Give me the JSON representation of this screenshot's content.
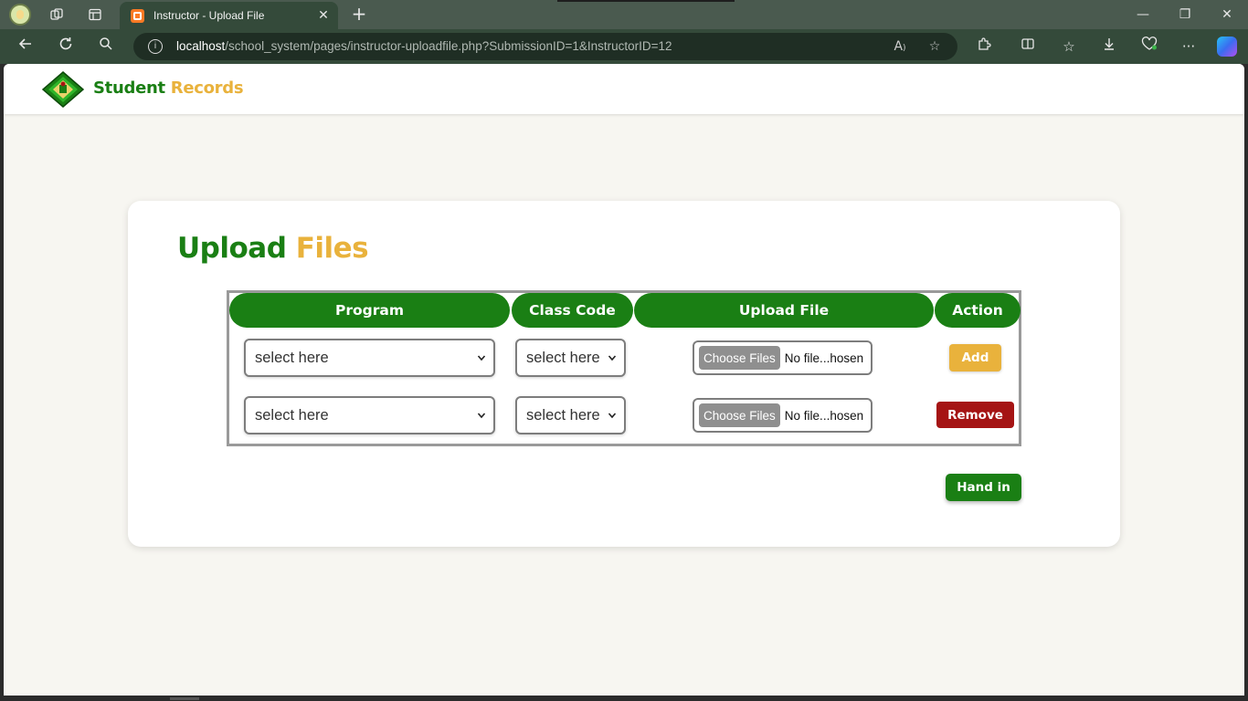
{
  "browser": {
    "tab_title": "Instructor - Upload File",
    "url_host": "localhost",
    "url_rest": "/school_system/pages/instructor-uploadfile.php?SubmissionID=1&InstructorID=12"
  },
  "site": {
    "brand_part1": "Student",
    "brand_part2": "Records"
  },
  "card": {
    "title_part1": "Upload",
    "title_part2": "Files"
  },
  "table": {
    "headers": [
      "Program",
      "Class Code",
      "Upload File",
      "Action"
    ],
    "rows": [
      {
        "program_selected": "select here",
        "class_code_selected": "select here",
        "file_button": "Choose Files",
        "file_status": "No file...hosen",
        "action": "Add"
      },
      {
        "program_selected": "select here",
        "class_code_selected": "select here",
        "file_button": "Choose Files",
        "file_status": "No file...hosen",
        "action": "Remove"
      }
    ]
  },
  "hand_in_label": "Hand in",
  "colors": {
    "green": "#1a7f14",
    "gold": "#e9b23c",
    "remove_red": "#a51414"
  }
}
